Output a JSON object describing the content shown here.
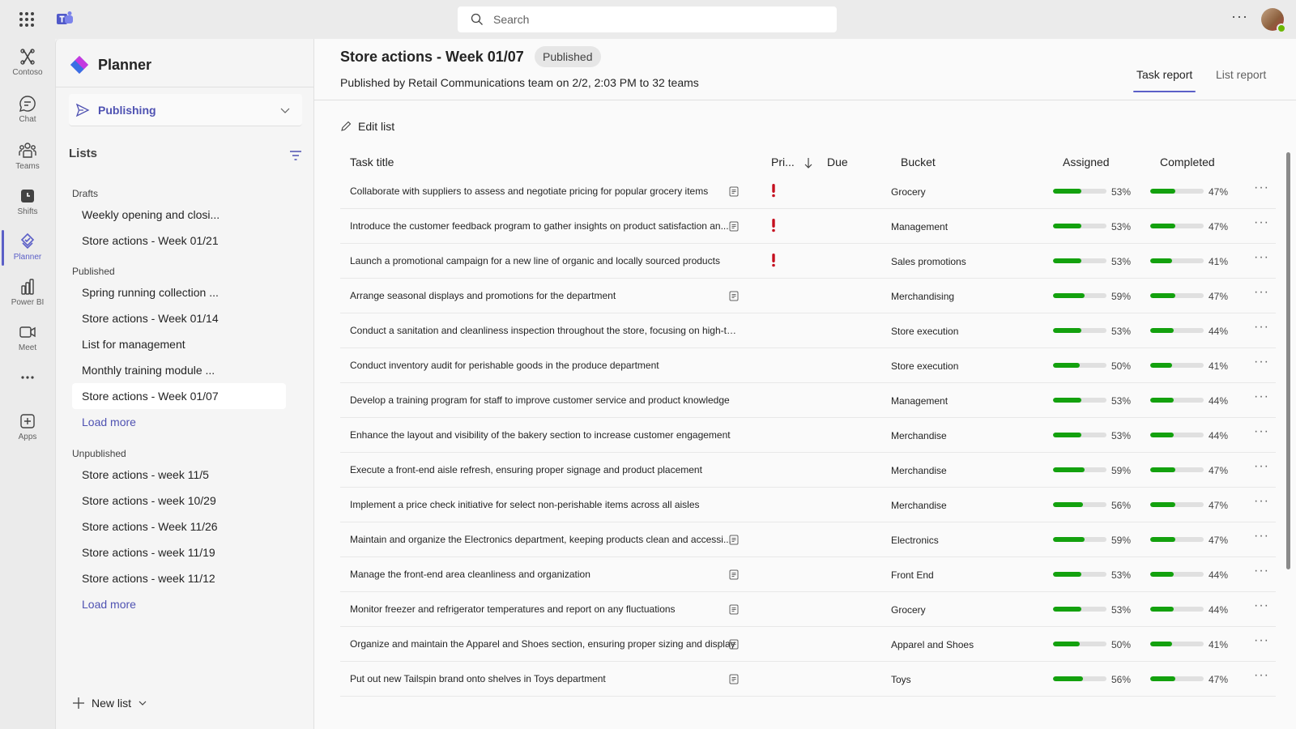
{
  "search": {
    "placeholder": "Search"
  },
  "top": {
    "more": "···"
  },
  "rail": [
    {
      "label": "Contoso",
      "icon": "contoso-icon"
    },
    {
      "label": "Chat",
      "icon": "chat-icon"
    },
    {
      "label": "Teams",
      "icon": "teams-icon"
    },
    {
      "label": "Shifts",
      "icon": "shifts-icon"
    },
    {
      "label": "Planner",
      "icon": "planner-icon",
      "active": true
    },
    {
      "label": "Power BI",
      "icon": "powerbi-icon"
    },
    {
      "label": "Meet",
      "icon": "meet-icon"
    },
    {
      "label": "",
      "icon": "more-apps-icon"
    },
    {
      "label": "Apps",
      "icon": "apps-icon"
    }
  ],
  "left": {
    "app_title": "Planner",
    "publishing": "Publishing",
    "lists_title": "Lists",
    "drafts_label": "Drafts",
    "drafts": [
      "Weekly opening and closi...",
      "Store actions - Week 01/21"
    ],
    "published_label": "Published",
    "published": [
      "Spring running collection ...",
      "Store actions - Week 01/14",
      "List for management",
      "Monthly training module ...",
      "Store actions - Week 01/07"
    ],
    "load_more": "Load more",
    "unpublished_label": "Unpublished",
    "unpublished": [
      "Store actions - week 11/5",
      "Store actions - week 10/29",
      "Store actions - Week 11/26",
      "Store actions - week 11/19",
      "Store actions - week 11/12"
    ],
    "new_list": "New list"
  },
  "main": {
    "title": "Store actions - Week 01/07",
    "badge": "Published",
    "subtitle": "Published by Retail Communications team on 2/2, 2:03 PM to 32 teams",
    "tabs": [
      "Task report",
      "List report"
    ],
    "edit_list": "Edit list",
    "columns": {
      "title": "Task title",
      "priority": "Pri...",
      "due": "Due",
      "bucket": "Bucket",
      "assigned": "Assigned",
      "completed": "Completed"
    },
    "colors": {
      "accent": "#5b5fc7",
      "bar": "#13a10e",
      "urgent": "#c50f1f"
    },
    "rows": [
      {
        "title": "Collaborate with suppliers to assess and negotiate pricing for popular grocery items",
        "note": true,
        "urgent": true,
        "bucket": "Grocery",
        "assigned": 53,
        "completed": 47
      },
      {
        "title": "Introduce the customer feedback program to gather insights on product satisfaction an...",
        "note": true,
        "urgent": true,
        "bucket": "Management",
        "assigned": 53,
        "completed": 47
      },
      {
        "title": "Launch a promotional campaign for a new line of organic and locally sourced products",
        "note": false,
        "urgent": true,
        "bucket": "Sales promotions",
        "assigned": 53,
        "completed": 41
      },
      {
        "title": "Arrange seasonal displays and promotions for the department",
        "note": true,
        "urgent": false,
        "bucket": "Merchandising",
        "assigned": 59,
        "completed": 47
      },
      {
        "title": "Conduct a sanitation and cleanliness inspection throughout the store, focusing on high-traf...",
        "note": false,
        "urgent": false,
        "bucket": "Store execution",
        "assigned": 53,
        "completed": 44
      },
      {
        "title": "Conduct inventory audit for perishable goods in the produce department",
        "note": false,
        "urgent": false,
        "bucket": "Store execution",
        "assigned": 50,
        "completed": 41
      },
      {
        "title": "Develop a training program for staff to improve customer service and product knowledge",
        "note": false,
        "urgent": false,
        "bucket": "Management",
        "assigned": 53,
        "completed": 44
      },
      {
        "title": "Enhance the layout and visibility of the bakery section to increase customer engagement",
        "note": false,
        "urgent": false,
        "bucket": "Merchandise",
        "assigned": 53,
        "completed": 44
      },
      {
        "title": "Execute a front-end aisle refresh, ensuring proper signage and product placement",
        "note": false,
        "urgent": false,
        "bucket": "Merchandise",
        "assigned": 59,
        "completed": 47
      },
      {
        "title": "Implement a price check initiative for select non-perishable items across all aisles",
        "note": false,
        "urgent": false,
        "bucket": "Merchandise",
        "assigned": 56,
        "completed": 47
      },
      {
        "title": "Maintain and organize the Electronics department, keeping products clean and accessi...",
        "note": true,
        "urgent": false,
        "bucket": "Electronics",
        "assigned": 59,
        "completed": 47
      },
      {
        "title": "Manage the front-end area cleanliness and organization",
        "note": true,
        "urgent": false,
        "bucket": "Front End",
        "assigned": 53,
        "completed": 44
      },
      {
        "title": "Monitor freezer and refrigerator temperatures and report on any fluctuations",
        "note": true,
        "urgent": false,
        "bucket": "Grocery",
        "assigned": 53,
        "completed": 44
      },
      {
        "title": "Organize and maintain the Apparel and Shoes section, ensuring proper sizing and display",
        "note": true,
        "urgent": false,
        "bucket": "Apparel and Shoes",
        "assigned": 50,
        "completed": 41
      },
      {
        "title": "Put out new Tailspin brand onto shelves in Toys department",
        "note": true,
        "urgent": false,
        "bucket": "Toys",
        "assigned": 56,
        "completed": 47
      }
    ]
  }
}
